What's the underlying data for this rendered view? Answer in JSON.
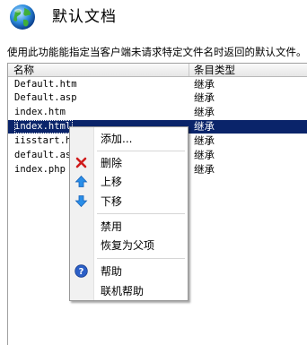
{
  "header": {
    "title": "默认文档"
  },
  "description": "使用此功能能指定当客户端未请求特定文件名时返回的默认文件。",
  "table": {
    "columns": [
      "名称",
      "条目类型"
    ],
    "rows": [
      {
        "name": "Default.htm",
        "type": "继承"
      },
      {
        "name": "Default.asp",
        "type": "继承"
      },
      {
        "name": "index.htm",
        "type": "继承"
      },
      {
        "name": "index.html",
        "type": "继承"
      },
      {
        "name": "iisstart.htm",
        "type": "继承"
      },
      {
        "name": "default.aspx",
        "type": "继承"
      },
      {
        "name": "index.php",
        "type": "继承"
      }
    ],
    "visible_names": [
      "Default.htm",
      "Default.asp",
      "index.htm",
      "index.html",
      "iisstart.h",
      "default.as",
      "index.php"
    ]
  },
  "context_menu": {
    "add": "添加...",
    "remove": "删除",
    "move_up": "上移",
    "move_down": "下移",
    "disable": "禁用",
    "revert": "恢复为父项",
    "help": "帮助",
    "online_help": "联机帮助"
  },
  "colors": {
    "selection": "#0a246a",
    "accent": "#1f6fd0",
    "remove": "#d01b1b"
  }
}
